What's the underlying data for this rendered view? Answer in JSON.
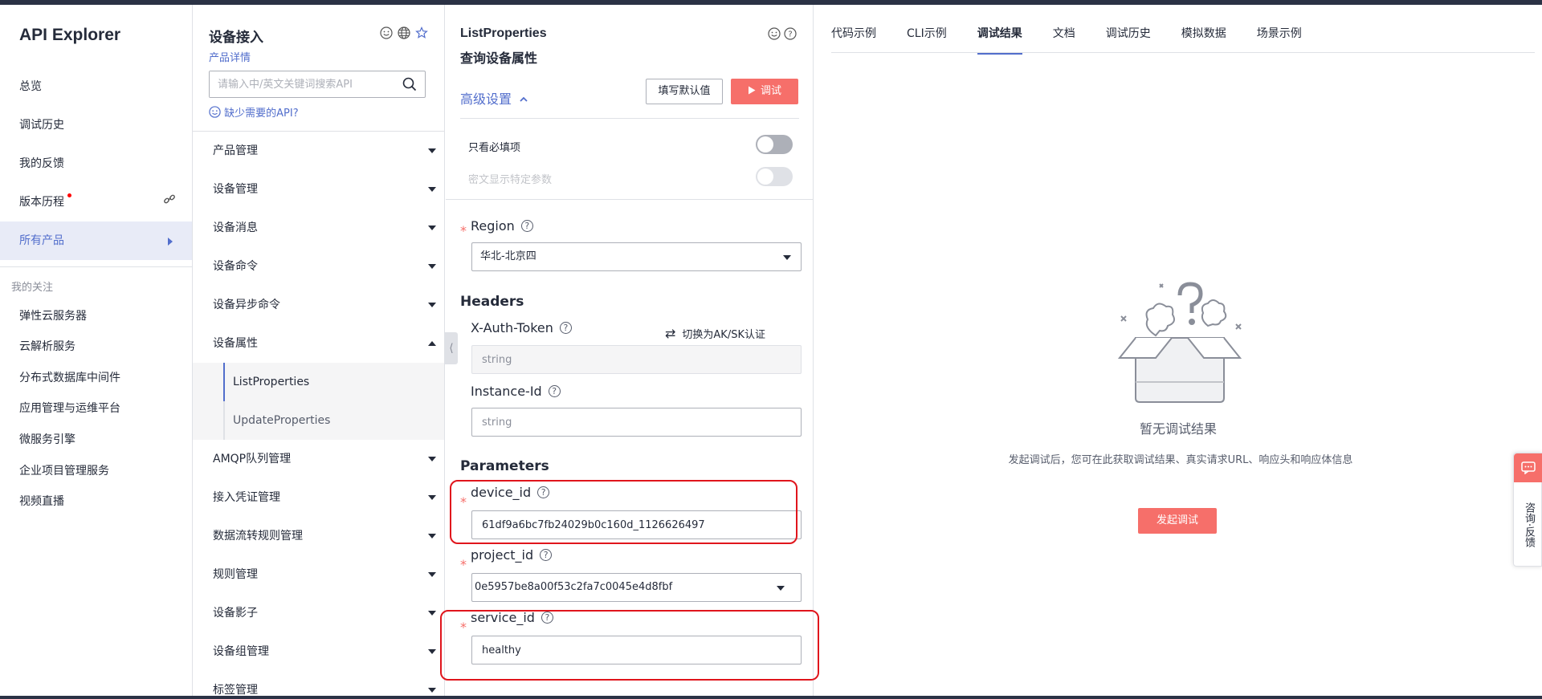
{
  "app": {
    "title": "API Explorer"
  },
  "leftnav": {
    "items": [
      {
        "label": "总览"
      },
      {
        "label": "调试历史"
      },
      {
        "label": "我的反馈"
      },
      {
        "label": "版本历程"
      },
      {
        "label": "所有产品"
      }
    ],
    "favorites_title": "我的关注",
    "favorites": [
      {
        "label": "弹性云服务器"
      },
      {
        "label": "云解析服务"
      },
      {
        "label": "分布式数据库中间件"
      },
      {
        "label": "应用管理与运维平台"
      },
      {
        "label": "微服务引擎"
      },
      {
        "label": "企业项目管理服务"
      },
      {
        "label": "视频直播"
      }
    ]
  },
  "catalog": {
    "title": "设备接入",
    "product_detail": "产品详情",
    "search_placeholder": "请输入中/英文关键词搜索API",
    "missing_api": "缺少需要的API?",
    "groups": [
      {
        "label": "产品管理"
      },
      {
        "label": "设备管理"
      },
      {
        "label": "设备消息"
      },
      {
        "label": "设备命令"
      },
      {
        "label": "设备异步命令"
      },
      {
        "label": "设备属性"
      },
      {
        "label": "AMQP队列管理"
      },
      {
        "label": "接入凭证管理"
      },
      {
        "label": "数据流转规则管理"
      },
      {
        "label": "规则管理"
      },
      {
        "label": "设备影子"
      },
      {
        "label": "设备组管理"
      },
      {
        "label": "标签管理"
      }
    ],
    "sub_items": [
      {
        "label": "ListProperties"
      },
      {
        "label": "UpdateProperties"
      }
    ]
  },
  "params": {
    "api_name": "ListProperties",
    "api_desc": "查询设备属性",
    "advanced": "高级设置",
    "fill_default": "填写默认值",
    "debug_button": "调试",
    "only_required": "只看必填项",
    "show_plain": "密文显示特定参数",
    "region_label": "Region",
    "region_value": "华北-北京四",
    "headers_title": "Headers",
    "auth_token_label": "X-Auth-Token",
    "switch_auth": "切换为AK/SK认证",
    "auth_token_placeholder": "string",
    "instance_id_label": "Instance-Id",
    "instance_id_placeholder": "string",
    "parameters_title": "Parameters",
    "device_id_label": "device_id",
    "device_id_value": "61df9a6bc7fb24029b0c160d_1126626497",
    "project_id_label": "project_id",
    "project_id_value": "0e5957be8a00f53c2fa7c0045e4d8fbf",
    "service_id_label": "service_id",
    "service_id_value": "healthy"
  },
  "results": {
    "tabs": [
      {
        "label": "代码示例"
      },
      {
        "label": "CLI示例"
      },
      {
        "label": "调试结果"
      },
      {
        "label": "文档"
      },
      {
        "label": "调试历史"
      },
      {
        "label": "模拟数据"
      },
      {
        "label": "场景示例"
      }
    ],
    "empty_title": "暂无调试结果",
    "empty_desc": "发起调试后，您可在此获取调试结果、真实请求URL、响应头和响应体信息",
    "start_button": "发起调试"
  },
  "feedback": {
    "label": "咨询·反馈"
  },
  "colors": {
    "accent": "#526ecc",
    "danger": "#f66f6a",
    "highlight": "#e0151c"
  }
}
